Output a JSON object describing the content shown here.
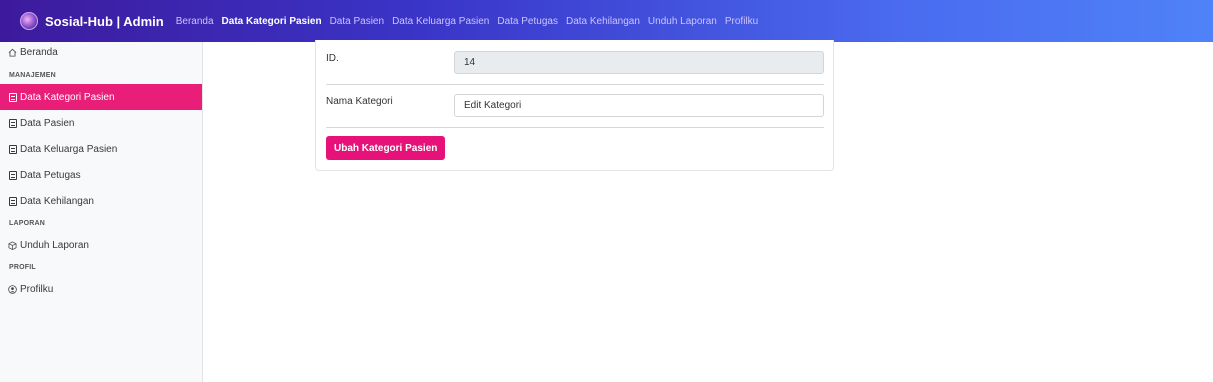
{
  "app": {
    "title": "Sosial-Hub | Admin"
  },
  "topnav": {
    "items": [
      {
        "label": "Beranda",
        "active": false
      },
      {
        "label": "Data Kategori Pasien",
        "active": true
      },
      {
        "label": "Data Pasien",
        "active": false
      },
      {
        "label": "Data Keluarga Pasien",
        "active": false
      },
      {
        "label": "Data Petugas",
        "active": false
      },
      {
        "label": "Data Kehilangan",
        "active": false
      },
      {
        "label": "Unduh Laporan",
        "active": false
      },
      {
        "label": "Profilku",
        "active": false
      }
    ]
  },
  "sidebar": {
    "home": {
      "label": "Beranda",
      "icon": "home-icon"
    },
    "sections": [
      {
        "heading": "MANAJEMEN",
        "items": [
          {
            "label": "Data Kategori Pasien",
            "icon": "document-icon",
            "active": true
          },
          {
            "label": "Data Pasien",
            "icon": "document-icon",
            "active": false
          },
          {
            "label": "Data Keluarga Pasien",
            "icon": "document-icon",
            "active": false
          },
          {
            "label": "Data Petugas",
            "icon": "document-icon",
            "active": false
          },
          {
            "label": "Data Kehilangan",
            "icon": "document-icon",
            "active": false
          }
        ]
      },
      {
        "heading": "LAPORAN",
        "items": [
          {
            "label": "Unduh Laporan",
            "icon": "box-icon",
            "active": false
          }
        ]
      },
      {
        "heading": "PROFIL",
        "items": [
          {
            "label": "Profilku",
            "icon": "user-circle-icon",
            "active": false
          }
        ]
      }
    ]
  },
  "form": {
    "id_label": "ID.",
    "id_value": "14",
    "name_label": "Nama Kategori",
    "name_value": "Edit Kategori",
    "submit_label": "Ubah Kategori Pasien"
  },
  "colors": {
    "accent": "#e91e78",
    "topbar_start": "#3d1a9c",
    "topbar_end": "#4f82f8"
  }
}
